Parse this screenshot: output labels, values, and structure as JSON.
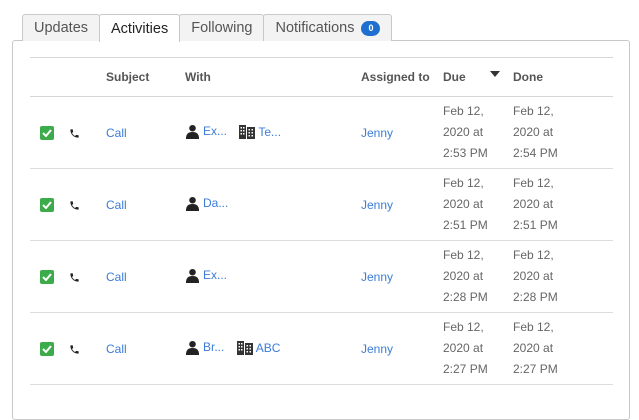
{
  "tabs": [
    {
      "label": "Updates"
    },
    {
      "label": "Activities"
    },
    {
      "label": "Following"
    },
    {
      "label": "Notifications",
      "badge": "0"
    }
  ],
  "table": {
    "headers": {
      "subject": "Subject",
      "with": "With",
      "assigned": "Assigned to",
      "due": "Due",
      "done": "Done"
    },
    "rows": [
      {
        "subject": "Call",
        "person": "Ex...",
        "company": "Te...",
        "assigned": "Jenny",
        "due": [
          "Feb 12,",
          "2020 at",
          "2:53 PM"
        ],
        "done": [
          "Feb 12,",
          "2020 at",
          "2:54 PM"
        ]
      },
      {
        "subject": "Call",
        "person": "Da...",
        "company": "",
        "assigned": "Jenny",
        "due": [
          "Feb 12,",
          "2020 at",
          "2:51 PM"
        ],
        "done": [
          "Feb 12,",
          "2020 at",
          "2:51 PM"
        ]
      },
      {
        "subject": "Call",
        "person": "Ex...",
        "company": "",
        "assigned": "Jenny",
        "due": [
          "Feb 12,",
          "2020 at",
          "2:28 PM"
        ],
        "done": [
          "Feb 12,",
          "2020 at",
          "2:28 PM"
        ]
      },
      {
        "subject": "Call",
        "person": "Br...",
        "company": "ABC",
        "assigned": "Jenny",
        "due": [
          "Feb 12,",
          "2020 at",
          "2:27 PM"
        ],
        "done": [
          "Feb 12,",
          "2020 at",
          "2:27 PM"
        ]
      }
    ]
  },
  "colors": {
    "accent": "#3b7dd8",
    "check": "#3cab4a",
    "badge": "#1f6fd1"
  },
  "icons": {
    "done": "checkbox-checked-icon",
    "type": "phone-icon",
    "person": "person-icon",
    "company": "building-icon",
    "sort": "caret-down-icon"
  }
}
